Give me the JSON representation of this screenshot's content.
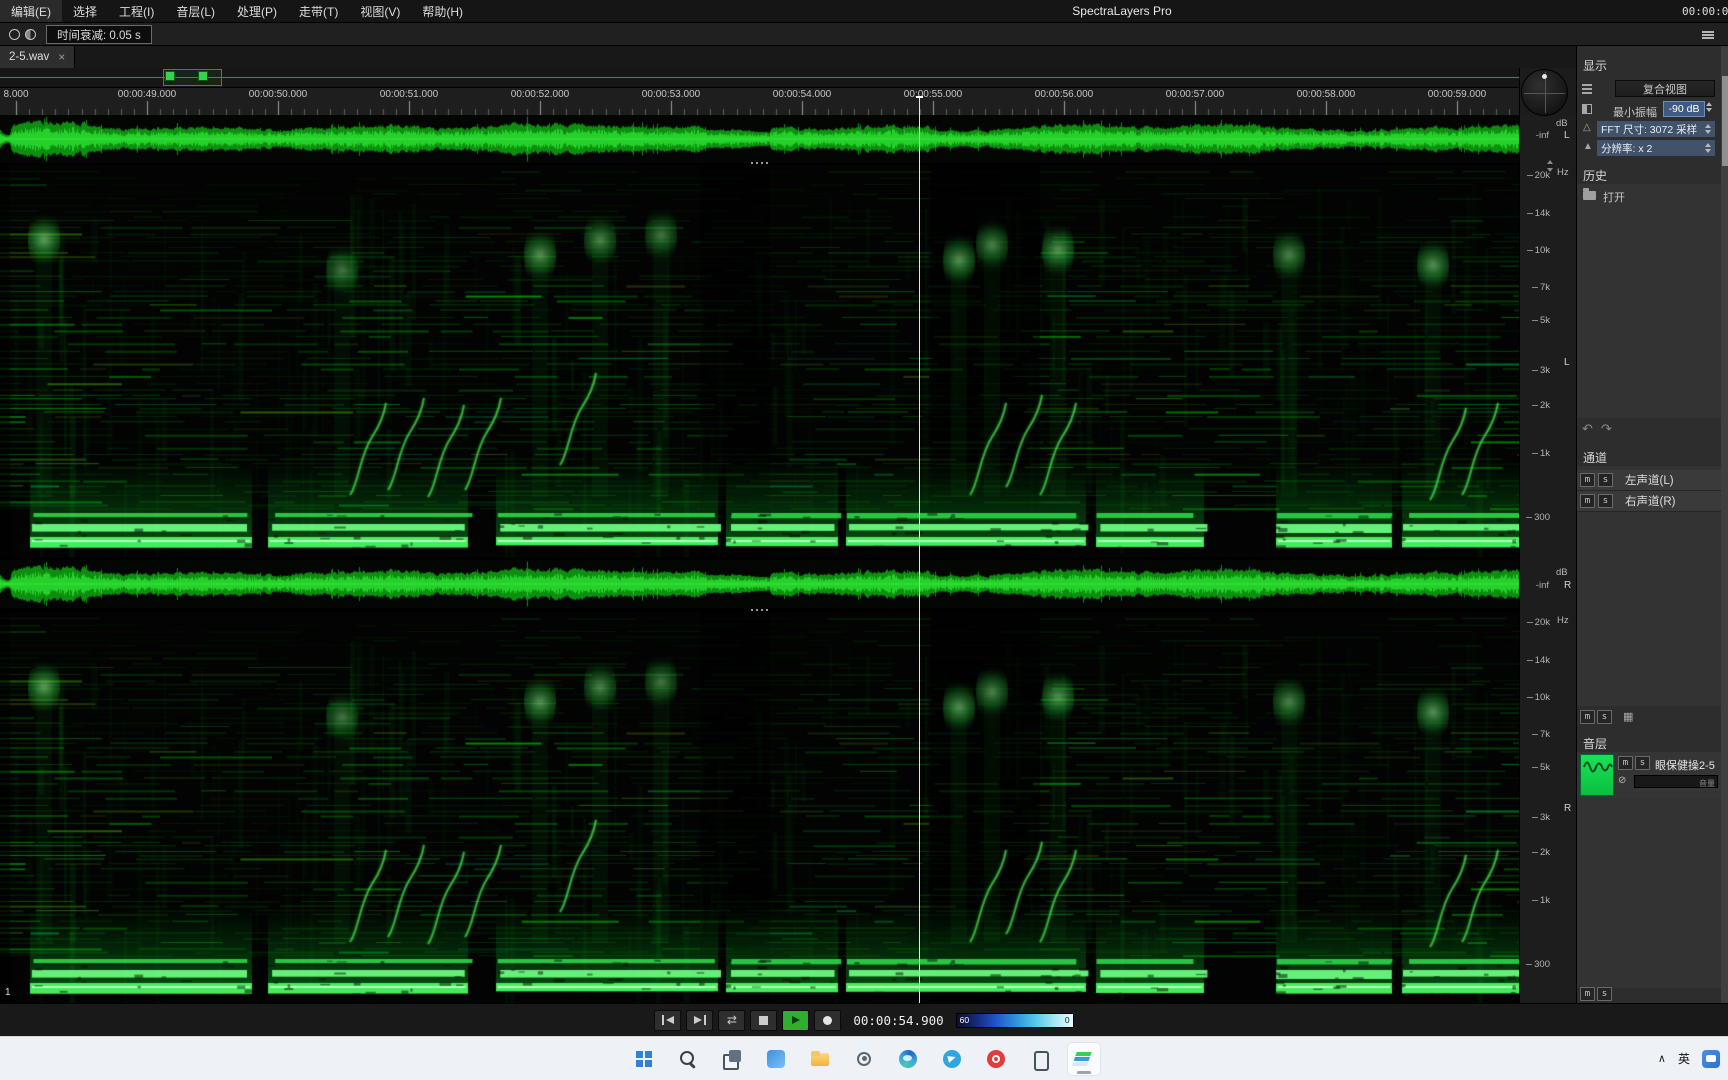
{
  "window": {
    "title": "SpectraLayers Pro",
    "menu_items": [
      "编辑(E)",
      "选择",
      "工程(I)",
      "音层(L)",
      "处理(P)",
      "走带(T)",
      "视图(V)",
      "帮助(H)"
    ],
    "menubar_timecode": "00:00:0"
  },
  "toolbar": {
    "time_fade": "时间衰减: 0.05 s"
  },
  "tabs": [
    {
      "label": "2-5.wav",
      "close": "×"
    }
  ],
  "ruler_labels": [
    "8.000",
    "00:00:49.000",
    "00:00:50.000",
    "00:00:51.000",
    "00:00:52.000",
    "00:00:53.000",
    "00:00:54.000",
    "00:00:55.000",
    "00:00:56.000",
    "00:00:57.000",
    "00:00:58.000",
    "00:00:59.000"
  ],
  "scale": {
    "db_unit": "dB",
    "hz_unit": "Hz",
    "neg_inf": "-inf",
    "freq_labels": [
      "20k",
      "14k",
      "10k",
      "7k",
      "5k",
      "3k",
      "2k",
      "1k",
      "300"
    ],
    "channel_left": "L",
    "channel_right": "R"
  },
  "marker_label": "1",
  "glyphs": {
    "undo": "↶",
    "redo": "↷",
    "bypass": "⊘",
    "grid": "▦",
    "triangle_open": "△",
    "triangle_solid": "▲"
  },
  "panels": {
    "display": {
      "header": "显示",
      "view_mode": "复合视图",
      "min_amplitude_label": "最小振幅",
      "min_amplitude_value": "-90 dB",
      "fft_size": "FFT 尺寸: 3072 采样",
      "resolution": "分辨率: x 2"
    },
    "history": {
      "header": "历史",
      "items": [
        {
          "label": "打开"
        }
      ]
    },
    "channels": {
      "header": "通道",
      "mute": "m",
      "solo": "s",
      "items": [
        {
          "name": "左声道(L)"
        },
        {
          "name": "右声道(R)"
        }
      ]
    },
    "layers": {
      "header": "音层",
      "items": [
        {
          "name": "眼保健操2-5",
          "volume_label": "音量"
        }
      ]
    }
  },
  "transport": {
    "buttons": [
      {
        "name": "skip-back-icon"
      },
      {
        "name": "skip-forward-icon"
      },
      {
        "name": "loop-icon"
      },
      {
        "name": "stop-icon"
      },
      {
        "name": "play-icon",
        "accent": true
      },
      {
        "name": "record-icon"
      }
    ],
    "timecode": "00:00:54.900",
    "colormap_min": "60",
    "colormap_max": "0"
  },
  "taskbar": {
    "icons": [
      {
        "name": "start-icon"
      },
      {
        "name": "search-icon"
      },
      {
        "name": "task-view-icon"
      },
      {
        "name": "widgets-icon"
      },
      {
        "name": "file-explorer-icon"
      },
      {
        "name": "settings-icon"
      },
      {
        "name": "edge-icon"
      },
      {
        "name": "telegram-icon"
      },
      {
        "name": "record-icon"
      },
      {
        "name": "phone-link-icon"
      },
      {
        "name": "spectralayers-icon",
        "active": true
      }
    ],
    "tray": {
      "chevron": "∧",
      "ime": "英"
    }
  }
}
